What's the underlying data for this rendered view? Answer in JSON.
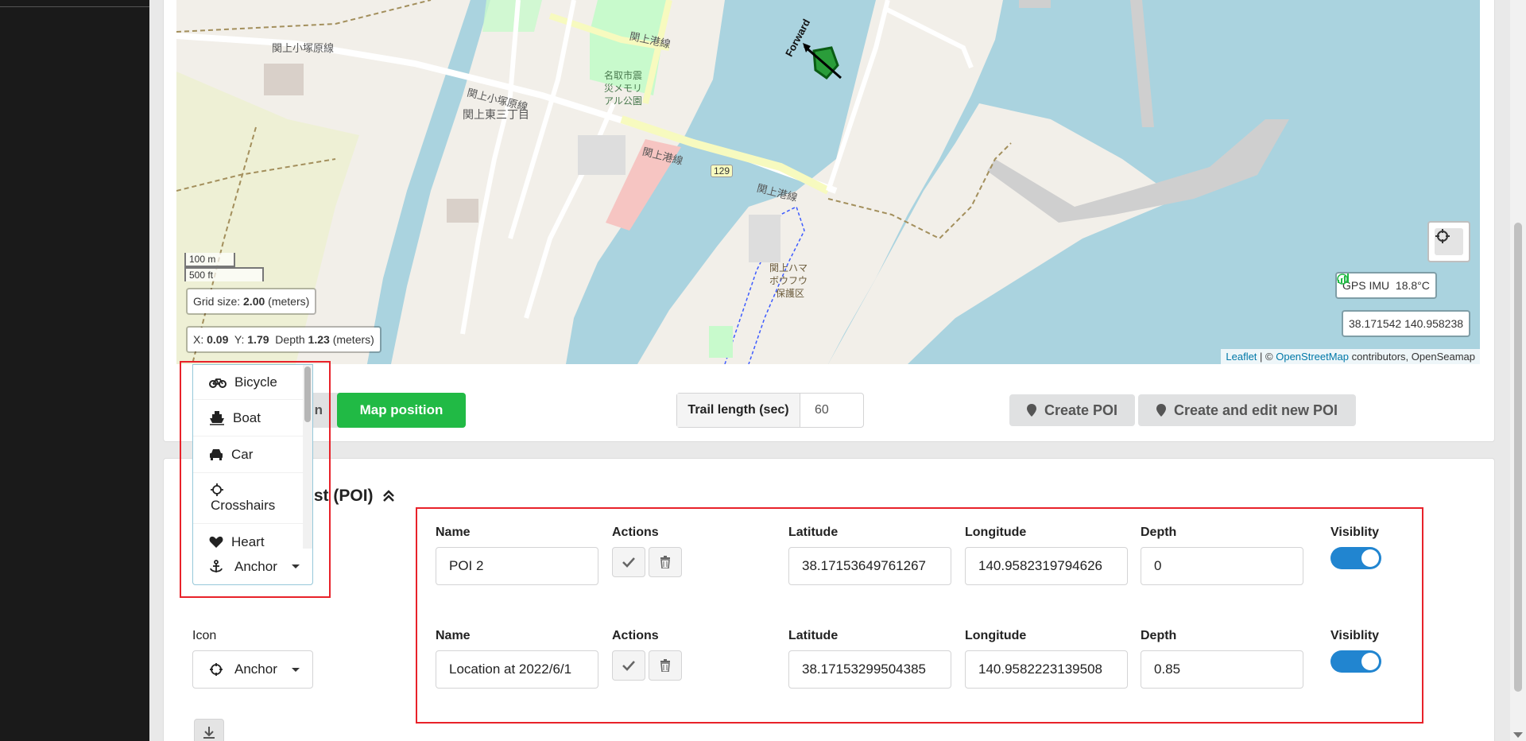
{
  "map": {
    "place_labels": [
      {
        "text": "関上小塚原線"
      },
      {
        "text": "関上小塚原線"
      },
      {
        "text": "関上港線"
      },
      {
        "text": "関上東三丁目"
      },
      {
        "text": "名取市震"
      },
      {
        "text": "災メモリ"
      },
      {
        "text": "アル公園"
      },
      {
        "text": "関上港線"
      },
      {
        "text": "関上港線"
      },
      {
        "text": "関上ハマ"
      },
      {
        "text": "ボウフウ"
      },
      {
        "text": "保護区"
      },
      {
        "text": "Forward"
      }
    ],
    "route_number": "129",
    "scale_m": "100 m",
    "scale_ft": "500 ft",
    "grid_label": "Grid size:",
    "grid_value": "2.00",
    "grid_unit": "(meters)",
    "pos_x_label": "X:",
    "pos_x": "0.09",
    "pos_y_label": "Y:",
    "pos_y": "1.79",
    "depth_label": "Depth",
    "depth": "1.23",
    "pos_unit": "(meters)",
    "status_gps": "GPS",
    "status_imu": "IMU",
    "temperature": "18.8°C",
    "coordinates": "38.171542 140.958238",
    "attribution_leaflet": "Leaflet",
    "attribution_sep": " | © ",
    "attribution_osm": "OpenStreetMap",
    "attribution_rest": " contributors, OpenSeamap",
    "colors": {
      "water": "#aad3df",
      "land": "#f2efe9",
      "park": "#c8facc",
      "road_yellow": "#f7fabf",
      "boundary": "#a38f5c"
    }
  },
  "toolbar": {
    "hidden_button_tail": "n",
    "map_position": "Map position",
    "trail_label": "Trail length (sec)",
    "trail_value": "60",
    "create_poi": "Create POI",
    "create_edit_poi": "Create and edit new POI",
    "accent_green": "#21ba45"
  },
  "icon_menu": {
    "items": [
      {
        "label": "Bicycle",
        "icon": "bicycle-icon"
      },
      {
        "label": "Boat",
        "icon": "ship-icon"
      },
      {
        "label": "Car",
        "icon": "car-icon"
      },
      {
        "label": "Crosshairs",
        "icon": "crosshairs-icon"
      },
      {
        "label": "Heart",
        "icon": "heart-icon"
      }
    ],
    "selected": "Anchor"
  },
  "poi": {
    "title_tail": "rest (POI)",
    "icon_label": "Icon",
    "headers": {
      "name": "Name",
      "actions": "Actions",
      "latitude": "Latitude",
      "longitude": "Longitude",
      "depth": "Depth",
      "visibility": "Visiblity"
    },
    "rows": [
      {
        "icon": "Anchor",
        "name": "POI 2",
        "latitude": "38.17153649761267",
        "longitude": "140.9582319794626",
        "depth": "0",
        "visible": true
      },
      {
        "icon": "Anchor",
        "name": "Location at 2022/6/1",
        "latitude": "38.17153299504385",
        "longitude": "140.9582223139508",
        "depth": "0.85",
        "visible": true
      }
    ]
  }
}
